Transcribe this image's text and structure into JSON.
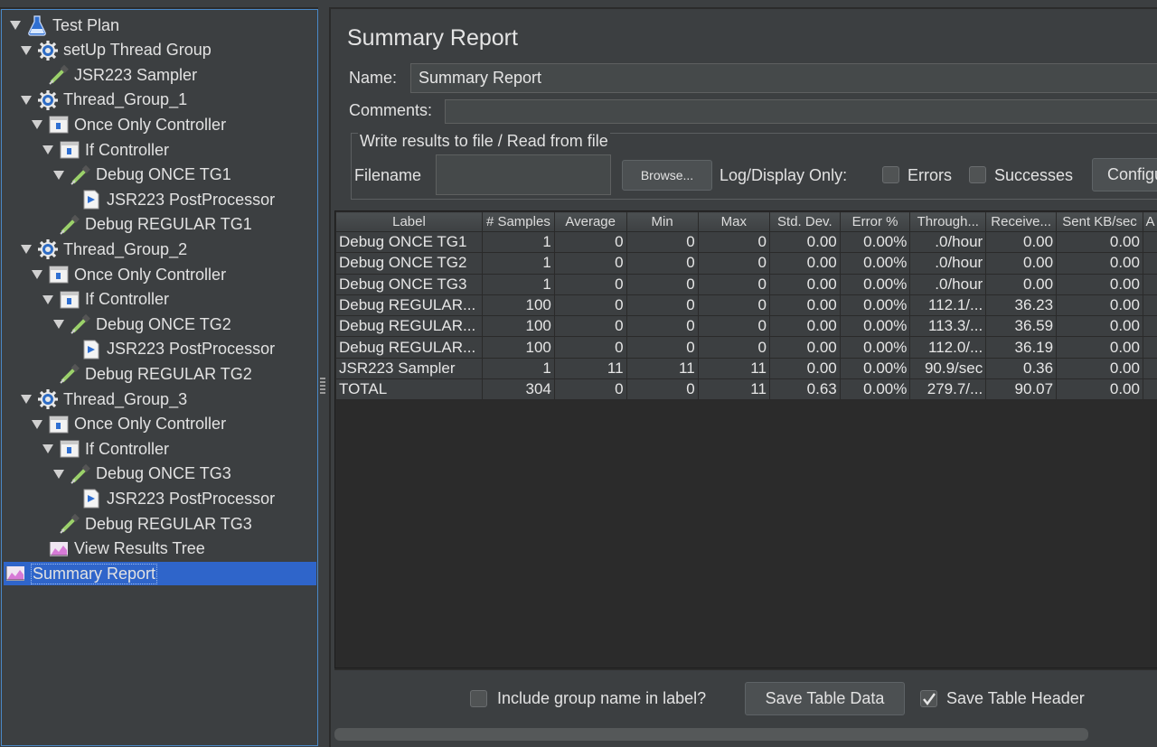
{
  "tree": {
    "items": [
      {
        "label": "Test Plan",
        "icon": "flask-icon",
        "arrow": "expanded"
      },
      {
        "label": "setUp Thread Group",
        "icon": "gear-icon",
        "arrow": "expanded"
      },
      {
        "label": "JSR223 Sampler",
        "icon": "pipette-icon",
        "arrow": "none"
      },
      {
        "label": "Thread_Group_1",
        "icon": "gear-icon",
        "arrow": "expanded"
      },
      {
        "label": "Once Only Controller",
        "icon": "controller-icon",
        "arrow": "expanded"
      },
      {
        "label": "If Controller",
        "icon": "controller-icon",
        "arrow": "expanded"
      },
      {
        "label": "Debug ONCE TG1",
        "icon": "pipette-icon",
        "arrow": "expanded"
      },
      {
        "label": "JSR223 PostProcessor",
        "icon": "postprocessor-icon",
        "arrow": "none"
      },
      {
        "label": "Debug REGULAR TG1",
        "icon": "pipette-icon",
        "arrow": "none"
      },
      {
        "label": "Thread_Group_2",
        "icon": "gear-icon",
        "arrow": "expanded"
      },
      {
        "label": "Once Only Controller",
        "icon": "controller-icon",
        "arrow": "expanded"
      },
      {
        "label": "If Controller",
        "icon": "controller-icon",
        "arrow": "expanded"
      },
      {
        "label": "Debug ONCE TG2",
        "icon": "pipette-icon",
        "arrow": "expanded"
      },
      {
        "label": "JSR223 PostProcessor",
        "icon": "postprocessor-icon",
        "arrow": "none"
      },
      {
        "label": "Debug REGULAR TG2",
        "icon": "pipette-icon",
        "arrow": "none"
      },
      {
        "label": "Thread_Group_3",
        "icon": "gear-icon",
        "arrow": "expanded"
      },
      {
        "label": "Once Only Controller",
        "icon": "controller-icon",
        "arrow": "expanded"
      },
      {
        "label": "If Controller",
        "icon": "controller-icon",
        "arrow": "expanded"
      },
      {
        "label": "Debug ONCE TG3",
        "icon": "pipette-icon",
        "arrow": "expanded"
      },
      {
        "label": "JSR223 PostProcessor",
        "icon": "postprocessor-icon",
        "arrow": "none"
      },
      {
        "label": "Debug REGULAR TG3",
        "icon": "pipette-icon",
        "arrow": "none"
      },
      {
        "label": "View Results Tree",
        "icon": "listener-icon",
        "arrow": "none"
      },
      {
        "label": "Summary Report",
        "icon": "listener-icon",
        "arrow": "none",
        "selected": true
      }
    ]
  },
  "panel": {
    "title": "Summary Report",
    "name_label": "Name:",
    "name_value": "Summary Report",
    "comments_label": "Comments:",
    "file_group_label": "Write results to file / Read from file",
    "filename_label": "Filename",
    "filename_value": "",
    "browse_label": "Browse...",
    "log_display_label": "Log/Display Only:",
    "errors_label": "Errors",
    "successes_label": "Successes",
    "configure_label": "Configure"
  },
  "table": {
    "headers": [
      "Label",
      "# Samples",
      "Average",
      "Min",
      "Max",
      "Std. Dev.",
      "Error %",
      "Through...",
      "Receive...",
      "Sent KB/sec",
      "A"
    ],
    "rows": [
      [
        "Debug ONCE TG1",
        "1",
        "0",
        "0",
        "0",
        "0.00",
        "0.00%",
        ".0/hour",
        "0.00",
        "0.00",
        ""
      ],
      [
        "Debug ONCE TG2",
        "1",
        "0",
        "0",
        "0",
        "0.00",
        "0.00%",
        ".0/hour",
        "0.00",
        "0.00",
        ""
      ],
      [
        "Debug ONCE TG3",
        "1",
        "0",
        "0",
        "0",
        "0.00",
        "0.00%",
        ".0/hour",
        "0.00",
        "0.00",
        ""
      ],
      [
        "Debug REGULAR...",
        "100",
        "0",
        "0",
        "0",
        "0.00",
        "0.00%",
        "112.1/...",
        "36.23",
        "0.00",
        ""
      ],
      [
        "Debug REGULAR...",
        "100",
        "0",
        "0",
        "0",
        "0.00",
        "0.00%",
        "113.3/...",
        "36.59",
        "0.00",
        ""
      ],
      [
        "Debug REGULAR...",
        "100",
        "0",
        "0",
        "0",
        "0.00",
        "0.00%",
        "112.0/...",
        "36.19",
        "0.00",
        ""
      ],
      [
        "JSR223 Sampler",
        "1",
        "11",
        "11",
        "11",
        "0.00",
        "0.00%",
        "90.9/sec",
        "0.36",
        "0.00",
        ""
      ],
      [
        "TOTAL",
        "304",
        "0",
        "0",
        "11",
        "0.63",
        "0.00%",
        "279.7/...",
        "90.07",
        "0.00",
        ""
      ]
    ]
  },
  "footer": {
    "include_group_label": "Include group name in label?",
    "include_group_checked": false,
    "save_table_data_label": "Save Table Data",
    "save_table_header_label": "Save Table Header",
    "save_table_header_checked": true
  },
  "colors": {
    "background": "#3c3f41",
    "selection": "#2f65ca",
    "focus_border": "#4a88c7"
  }
}
